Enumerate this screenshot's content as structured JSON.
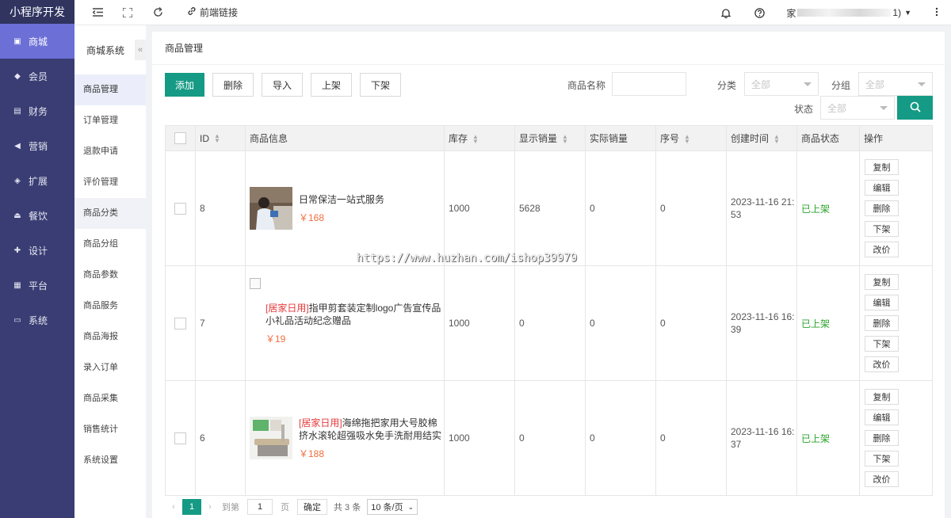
{
  "app": {
    "title": "小程序开发"
  },
  "sidebar": {
    "items": [
      {
        "label": "商城",
        "icon": "shop-icon"
      },
      {
        "label": "会员",
        "icon": "member-icon"
      },
      {
        "label": "财务",
        "icon": "finance-icon"
      },
      {
        "label": "营销",
        "icon": "marketing-icon"
      },
      {
        "label": "扩展",
        "icon": "extension-icon"
      },
      {
        "label": "餐饮",
        "icon": "dining-icon"
      },
      {
        "label": "设计",
        "icon": "design-icon"
      },
      {
        "label": "平台",
        "icon": "platform-icon"
      },
      {
        "label": "系统",
        "icon": "system-icon"
      }
    ],
    "active_index": 0
  },
  "topbar": {
    "link_label": "前端链接",
    "user_prefix": "家",
    "user_suffix": "1)"
  },
  "submenu": {
    "title": "商城系统",
    "items": [
      "商品管理",
      "订单管理",
      "退款申请",
      "评价管理",
      "商品分类",
      "商品分组",
      "商品参数",
      "商品服务",
      "商品海报",
      "录入订单",
      "商品采集",
      "销售统计",
      "系统设置"
    ],
    "active_index": 0
  },
  "page": {
    "title": "商品管理"
  },
  "toolbar": {
    "add": "添加",
    "delete": "删除",
    "import": "导入",
    "on_shelf": "上架",
    "off_shelf": "下架"
  },
  "filters": {
    "name_label": "商品名称",
    "category_label": "分类",
    "category_value": "全部",
    "group_label": "分组",
    "group_value": "全部",
    "status_label": "状态",
    "status_value": "全部"
  },
  "table": {
    "headers": [
      "ID",
      "商品信息",
      "库存",
      "显示销量",
      "实际销量",
      "序号",
      "创建时间",
      "商品状态",
      "操作"
    ],
    "rows": [
      {
        "id": "8",
        "tag": "",
        "name": "日常保洁一站式服务",
        "price": "￥168",
        "stock": "1000",
        "shown_sales": "5628",
        "real_sales": "0",
        "order": "0",
        "created": "2023-11-16 21:53",
        "status": "已上架"
      },
      {
        "id": "7",
        "tag": "[居家日用]",
        "name": "指甲剪套装定制logo广告宣传品小礼品活动纪念赠品",
        "price": "￥19",
        "stock": "1000",
        "shown_sales": "0",
        "real_sales": "0",
        "order": "0",
        "created": "2023-11-16 16:39",
        "status": "已上架"
      },
      {
        "id": "6",
        "tag": "[居家日用]",
        "name": "海绵拖把家用大号胶棉挤水滚轮超强吸水免手洗耐用结实",
        "price": "￥188",
        "stock": "1000",
        "shown_sales": "0",
        "real_sales": "0",
        "order": "0",
        "created": "2023-11-16 16:37",
        "status": "已上架"
      }
    ],
    "ops": [
      "复制",
      "编辑",
      "删除",
      "下架",
      "改价"
    ]
  },
  "watermark": "https://www.huzhan.com/ishop39979",
  "pager": {
    "current": "1",
    "goto_label": "到第",
    "goto_value": "1",
    "page_unit": "页",
    "confirm": "确定",
    "total": "共 3 条",
    "page_size": "10 条/页"
  }
}
